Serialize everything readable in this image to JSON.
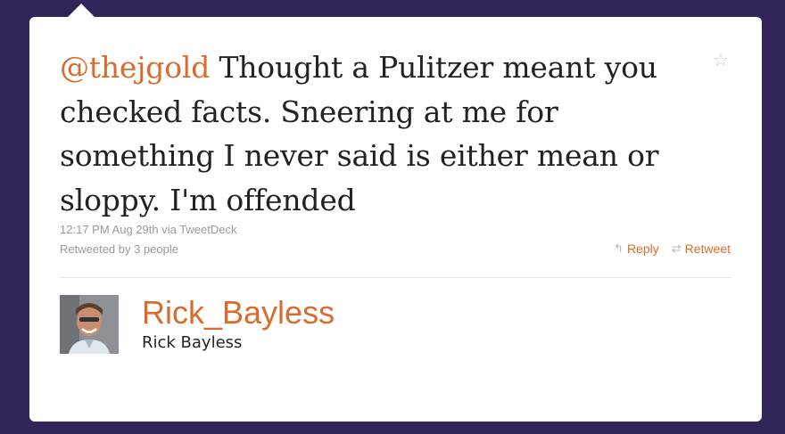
{
  "tweet": {
    "mention": "@thejgold",
    "text": " Thought a Pulitzer meant you checked facts. Sneering at me for something I never said is either mean or sloppy. I'm offended",
    "meta": "12:17 PM Aug 29th via TweetDeck",
    "retweeted": "Retweeted by 3 people"
  },
  "actions": {
    "reply_label": "Reply",
    "retweet_label": "Retweet",
    "reply_icon": "reply-icon",
    "retweet_icon": "retweet-icon",
    "favorite_icon": "star-icon"
  },
  "author": {
    "username": "Rick_Bayless",
    "name": "Rick Bayless"
  },
  "colors": {
    "accent": "#d96c2c",
    "background": "#33245a",
    "card": "#ffffff"
  }
}
